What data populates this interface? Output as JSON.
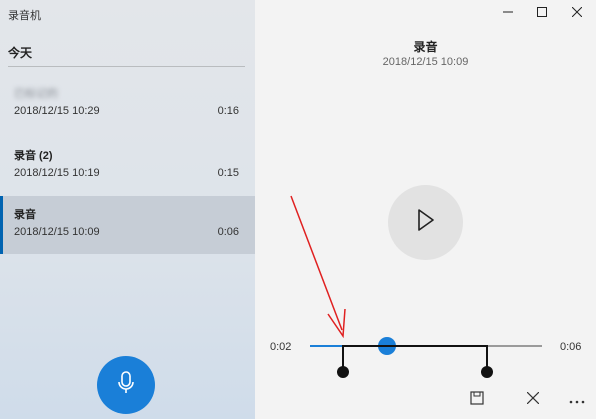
{
  "app": {
    "title": "录音机"
  },
  "sidebar": {
    "section_title": "今天",
    "recordings": [
      {
        "name": "已标记的",
        "date": "2018/12/15 10:29",
        "duration": "0:16"
      },
      {
        "name": "录音 (2)",
        "date": "2018/12/15 10:19",
        "duration": "0:15"
      },
      {
        "name": "录音",
        "date": "2018/12/15 10:09",
        "duration": "0:06"
      }
    ]
  },
  "player": {
    "title": "录音",
    "date": "2018/12/15 10:09",
    "time_start": "0:02",
    "time_end": "0:06",
    "progress_fraction": 0.33
  },
  "colors": {
    "accent": "#1a7fd8",
    "annotation_red": "#e02020"
  },
  "icons": [
    "mic-icon",
    "play-icon",
    "minimize-icon",
    "maximize-icon",
    "close-icon",
    "save-icon",
    "cancel-icon",
    "more-icon"
  ]
}
